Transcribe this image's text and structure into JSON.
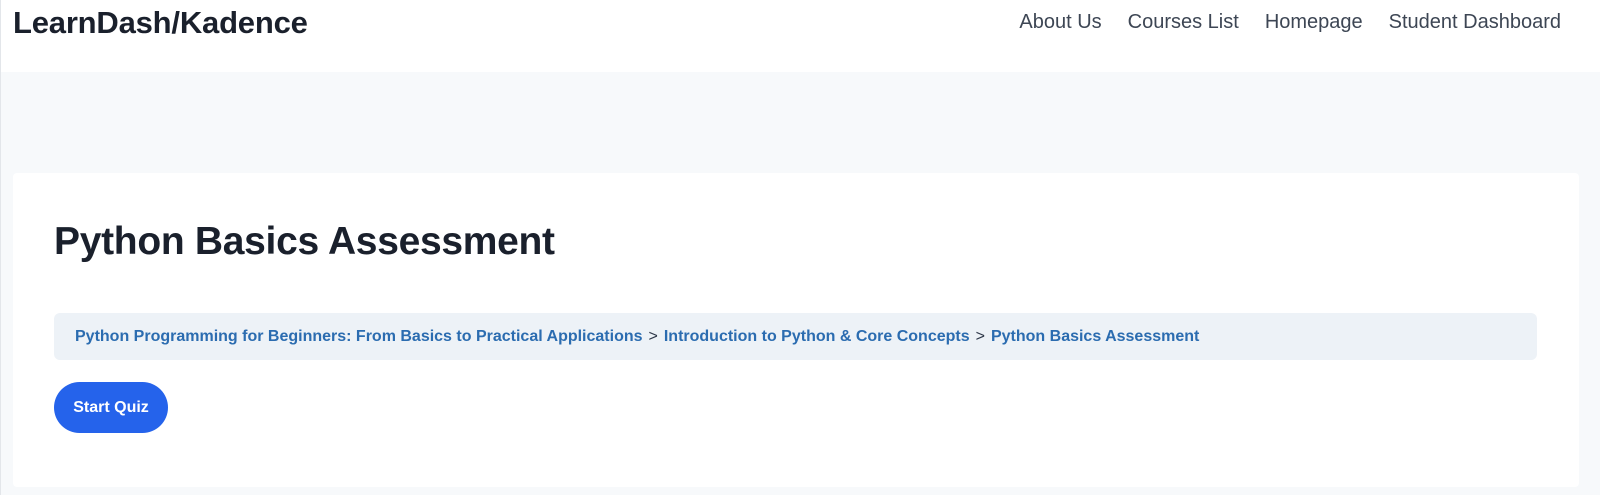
{
  "header": {
    "brand": "LearnDash/Kadence",
    "nav": [
      {
        "label": "About Us"
      },
      {
        "label": "Courses List"
      },
      {
        "label": "Homepage"
      },
      {
        "label": "Student Dashboard"
      }
    ]
  },
  "main": {
    "title": "Python Basics Assessment",
    "breadcrumb": {
      "items": [
        {
          "label": "Python Programming for Beginners: From Basics to Practical Applications"
        },
        {
          "label": "Introduction to Python & Core Concepts"
        },
        {
          "label": "Python Basics Assessment"
        }
      ],
      "separator": ">"
    },
    "start_quiz_label": "Start Quiz"
  },
  "colors": {
    "accent_button": "#2563eb",
    "breadcrumb_link": "#2b6cb0",
    "breadcrumb_bg": "#edf2f7",
    "page_bg": "#f7f9fb"
  }
}
